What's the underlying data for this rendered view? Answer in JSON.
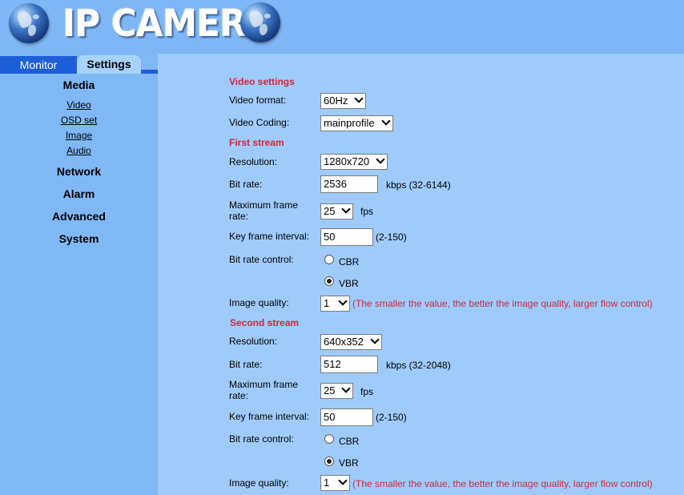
{
  "header": {
    "logo_text": "IP CAMERA"
  },
  "tabs": {
    "monitor": "Monitor",
    "settings": "Settings"
  },
  "sidebar": {
    "media": "Media",
    "media_links": [
      "Video",
      "OSD set",
      "Image",
      "Audio"
    ],
    "network": "Network",
    "alarm": "Alarm",
    "advanced": "Advanced",
    "system": "System"
  },
  "video_settings": {
    "heading": "Video settings",
    "format_label": "Video format:",
    "format_value": "60Hz",
    "coding_label": "Video Coding:",
    "coding_value": "mainprofile"
  },
  "first_stream": {
    "heading": "First stream",
    "resolution_label": "Resolution:",
    "resolution_value": "1280x720",
    "bitrate_label": "Bit rate:",
    "bitrate_value": "2536",
    "bitrate_hint": "kbps (32-6144)",
    "framerate_label_1": "Maximum frame",
    "framerate_label_2": "rate:",
    "framerate_value": "25",
    "framerate_unit": "fps",
    "keyframe_label": "Key frame interval:",
    "keyframe_value": "50",
    "keyframe_hint": "(2-150)",
    "bitrate_control_label": "Bit rate control:",
    "cbr_label": "CBR",
    "vbr_label": "VBR",
    "selected_control": "VBR",
    "quality_label": "Image quality:",
    "quality_value": "1",
    "quality_hint": "(The smaller the value, the better the image quality, larger flow control)"
  },
  "second_stream": {
    "heading": "Second stream",
    "resolution_label": "Resolution:",
    "resolution_value": "640x352",
    "bitrate_label": "Bit rate:",
    "bitrate_value": "512",
    "bitrate_hint": "kbps (32-2048)",
    "framerate_label_1": "Maximum frame",
    "framerate_label_2": "rate:",
    "framerate_value": "25",
    "framerate_unit": "fps",
    "keyframe_label": "Key frame interval:",
    "keyframe_value": "50",
    "keyframe_hint": "(2-150)",
    "bitrate_control_label": "Bit rate control:",
    "cbr_label": "CBR",
    "vbr_label": "VBR",
    "selected_control": "VBR",
    "quality_label": "Image quality:",
    "quality_value": "1",
    "quality_hint": "(The smaller the value, the better the image quality, larger flow control)"
  },
  "colors": {
    "header_bg": "#7fb7f6",
    "sidebar_bg": "#80b8f6",
    "main_bg": "#9fcbfa",
    "tab_active_bar": "#1d5fd6",
    "heading_red": "#d0283a"
  }
}
